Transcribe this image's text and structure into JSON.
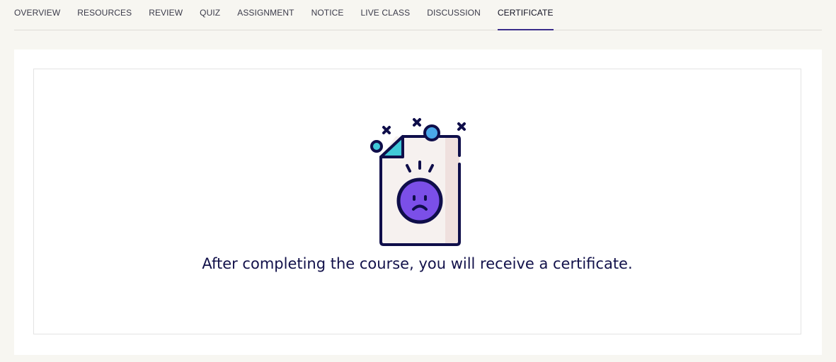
{
  "tabs": [
    {
      "label": "OVERVIEW"
    },
    {
      "label": "RESOURCES"
    },
    {
      "label": "REVIEW"
    },
    {
      "label": "QUIZ"
    },
    {
      "label": "ASSIGNMENT"
    },
    {
      "label": "NOTICE"
    },
    {
      "label": "LIVE CLASS"
    },
    {
      "label": "DISCUSSION"
    },
    {
      "label": "CERTIFICATE",
      "active": true
    }
  ],
  "certificate": {
    "icon": "sad-document-icon",
    "message": "After completing the course, you will receive a certificate."
  },
  "colors": {
    "accent": "#3a2c8a",
    "text_dark": "#12114a",
    "face": "#7b4fe8",
    "corner": "#40c9d8",
    "pin": "#4aa8e8",
    "background": "#f7f6f1"
  }
}
